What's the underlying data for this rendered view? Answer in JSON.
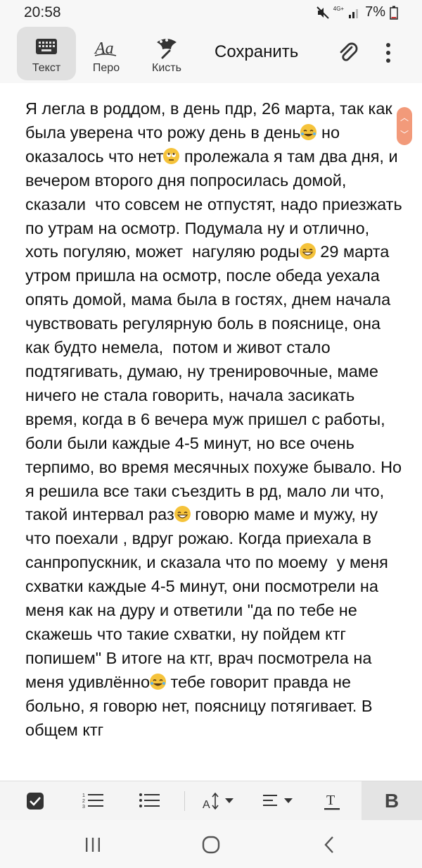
{
  "status_bar": {
    "time": "20:58",
    "network": "4G+",
    "battery": "7%"
  },
  "toolbar": {
    "modes": [
      {
        "label": "Текст",
        "icon": "keyboard-icon",
        "active": true
      },
      {
        "label": "Перо",
        "icon": "pen-text-icon",
        "active": false
      },
      {
        "label": "Кисть",
        "icon": "brush-icon",
        "active": false
      }
    ],
    "save_label": "Сохранить",
    "attach_icon": "paperclip-icon",
    "more_icon": "more-vertical-icon"
  },
  "note": {
    "segments": [
      "Я легла в роддом, в день пдр, 26 марта, так как была уверена что рожу день в день",
      " но оказалось что нет",
      " пролежала я там два дня, и вечером второго дня попросилась домой, сказали  что совсем не отпустят, надо приезжать по утрам на осмотр. Подумала ну и отлично, хоть погуляю, может  нагуляю роды",
      " 29 марта утром пришла на осмотр, после обеда уехала опять домой, мама была в гостях, днем начала чувствовать регулярную боль в пояснице, она как будто немела,  потом и живот стало подтягивать, думаю, ну тренировочные, маме ничего не стала говорить, начала засикать время, когда в 6 вечера муж пришел с работы, боли были каждые 4-5 минут, но все очень терпимо, во время месячных похуже бывало. Но я решила все таки съездить в рд, мало ли что, такой интервал раз",
      " говорю маме и мужу, ну что поехали , вдруг рожаю. Когда приехала в санпропускник, и сказала что по моему  у меня схватки каждые 4-5 минут, они посмотрели на меня как на дуру и ответили \"да по тебе не скажешь что такие схватки, ну пойдем ктг попишем\" В итоге на ктг, врач посмотрела на меня удивлённо",
      " тебе говорит правда не больно, я говорю нет, поясницу потягивает. В общем ктг"
    ],
    "emojis": [
      "laughing-tears-emoji",
      "eye-roll-emoji",
      "grinning-emoji",
      "grinning-emoji",
      "laughing-tears-emoji"
    ]
  },
  "format_bar": {
    "items": [
      "checkbox-icon",
      "numbered-list-icon",
      "bullet-list-icon",
      "font-size-icon",
      "align-icon",
      "text-color-icon"
    ],
    "bold_label": "B"
  },
  "nav_bar": {
    "items": [
      "recents-icon",
      "home-icon",
      "back-icon"
    ]
  },
  "colors": {
    "accent_scroll": "#f29a7a",
    "active_mode_bg": "#e0e0e0",
    "emoji": "#f5c33b"
  }
}
